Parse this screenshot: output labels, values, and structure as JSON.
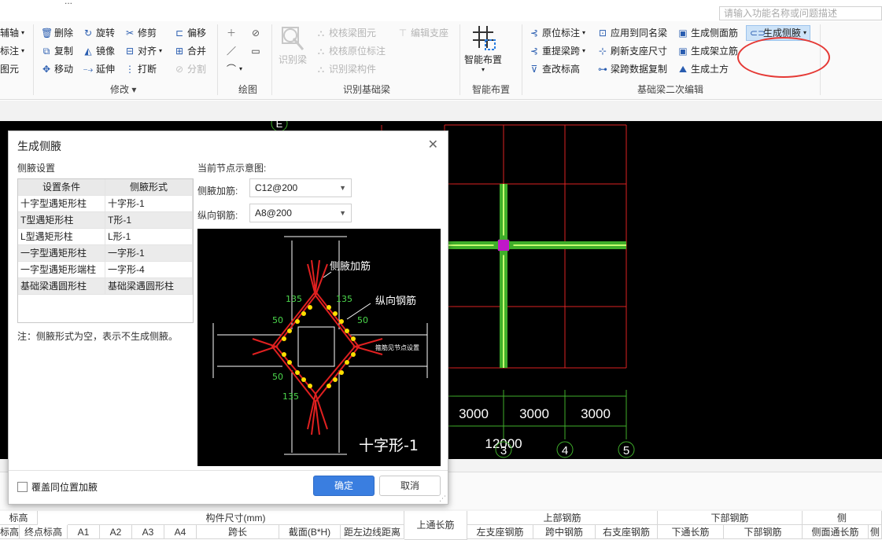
{
  "window": {
    "title_fragment": "...",
    "search_placeholder": "请输入功能名称或问题描述"
  },
  "ribbon": {
    "left_cut": [
      {
        "label": "辅轴"
      },
      {
        "label": "标注"
      },
      {
        "label": "图元"
      }
    ],
    "modify": {
      "label": "修改",
      "items": [
        {
          "label": "删除",
          "icon": "delete-icon"
        },
        {
          "label": "复制",
          "icon": "copy-icon"
        },
        {
          "label": "移动",
          "icon": "move-icon"
        },
        {
          "label": "旋转",
          "icon": "rotate-icon"
        },
        {
          "label": "镜像",
          "icon": "mirror-icon"
        },
        {
          "label": "延伸",
          "icon": "extend-icon"
        },
        {
          "label": "修剪",
          "icon": "trim-icon"
        },
        {
          "label": "对齐",
          "icon": "align-icon"
        },
        {
          "label": "打断",
          "icon": "break-icon"
        },
        {
          "label": "偏移",
          "icon": "offset-icon"
        },
        {
          "label": "合并",
          "icon": "merge-icon"
        },
        {
          "label": "分割",
          "icon": "split-icon"
        }
      ]
    },
    "draw": {
      "label": "绘图"
    },
    "identify": {
      "label": "识别基础梁",
      "big_button": "识别梁",
      "items": [
        {
          "label": "校核梁图元"
        },
        {
          "label": "编辑支座"
        },
        {
          "label": "校核原位标注"
        },
        {
          "label": "识别梁构件"
        }
      ]
    },
    "smart": {
      "label": "智能布置",
      "button": "智能布置"
    },
    "secondary": {
      "label": "基础梁二次编辑",
      "items": [
        {
          "label": "原位标注"
        },
        {
          "label": "重提梁跨"
        },
        {
          "label": "查改标高"
        },
        {
          "label": "应用到同名梁"
        },
        {
          "label": "刷新支座尺寸"
        },
        {
          "label": "梁跨数据复制"
        },
        {
          "label": "生成侧面筋"
        },
        {
          "label": "生成架立筋"
        },
        {
          "label": "生成土方"
        },
        {
          "label": "生成侧腋"
        }
      ]
    }
  },
  "canvas": {
    "axis_label_e": "E",
    "dims": [
      "3000",
      "3000",
      "3000"
    ],
    "total_dim": "12000",
    "axes": [
      "3",
      "4",
      "5"
    ]
  },
  "bottom_table": {
    "headers_top": [
      "标高",
      "构件尺寸(mm)",
      "上通长筋",
      "上部钢筋",
      "下部钢筋",
      "侧"
    ],
    "headers_sub": [
      "标高",
      "终点标高",
      "A1",
      "A2",
      "A3",
      "A4",
      "跨长",
      "截面(B*H)",
      "距左边线距离",
      "左支座钢筋",
      "跨中钢筋",
      "右支座钢筋",
      "下通长筋",
      "下部钢筋",
      "侧面通长筋",
      "侧"
    ]
  },
  "dialog": {
    "title": "生成侧腋",
    "settings_label": "侧腋设置",
    "table_headers": [
      "设置条件",
      "侧腋形式"
    ],
    "rows": [
      [
        "十字型遇矩形柱",
        "十字形-1"
      ],
      [
        "T型遇矩形柱",
        "T形-1"
      ],
      [
        "L型遇矩形柱",
        "L形-1"
      ],
      [
        "一字型遇矩形柱",
        "一字形-1"
      ],
      [
        "一字型遇矩形端柱",
        "一字形-4"
      ],
      [
        "基础梁遇圆形柱",
        "基础梁遇圆形柱"
      ]
    ],
    "note": "注：侧腋形式为空，表示不生成侧腋。",
    "schematic_label": "当前节点示意图:",
    "side_rebar_label": "侧腋加筋:",
    "side_rebar_value": "C12@200",
    "long_rebar_label": "纵向钢筋:",
    "long_rebar_value": "A8@200",
    "preview": {
      "callout_1": "侧腋加筋",
      "callout_2": "纵向钢筋",
      "dim_135": "135",
      "dim_50": "50",
      "side_note": "箍筋见节点设置",
      "caption": "十字形-1"
    },
    "checkbox_label": "覆盖同位置加腋",
    "ok": "确定",
    "cancel": "取消"
  }
}
